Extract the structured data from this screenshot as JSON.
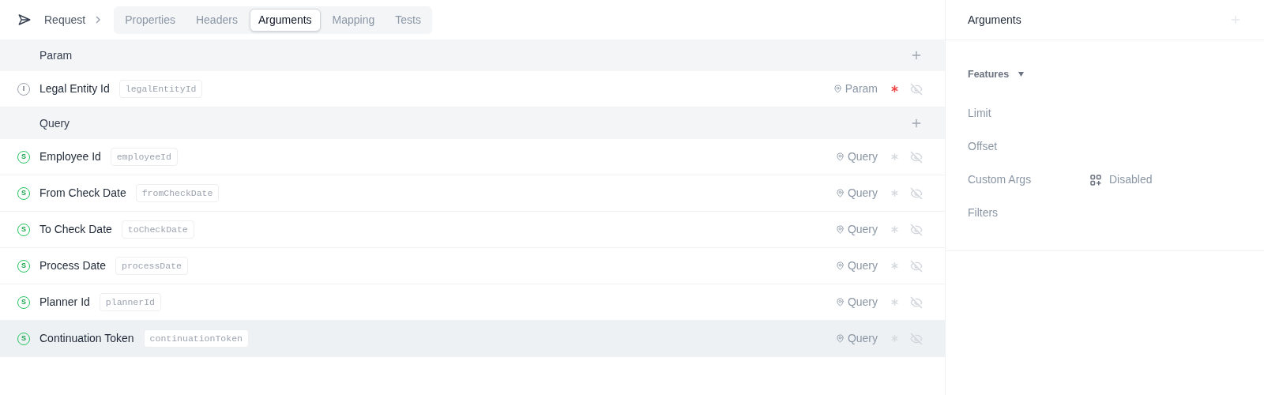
{
  "breadcrumb": {
    "label": "Request"
  },
  "tabs": [
    {
      "label": "Properties",
      "selected": false
    },
    {
      "label": "Headers",
      "selected": false
    },
    {
      "label": "Arguments",
      "selected": true
    },
    {
      "label": "Mapping",
      "selected": false
    },
    {
      "label": "Tests",
      "selected": false
    }
  ],
  "sections": [
    {
      "title": "Param",
      "rows": [
        {
          "name": "Legal Entity Id",
          "key": "legalEntityId",
          "kind": "integer",
          "type_letter": "I",
          "location": "Param",
          "required": true,
          "hovered": false
        }
      ]
    },
    {
      "title": "Query",
      "rows": [
        {
          "name": "Employee Id",
          "key": "employeeId",
          "kind": "string",
          "type_letter": "S",
          "location": "Query",
          "required": false,
          "hovered": false
        },
        {
          "name": "From Check Date",
          "key": "fromCheckDate",
          "kind": "string",
          "type_letter": "S",
          "location": "Query",
          "required": false,
          "hovered": false
        },
        {
          "name": "To Check Date",
          "key": "toCheckDate",
          "kind": "string",
          "type_letter": "S",
          "location": "Query",
          "required": false,
          "hovered": false
        },
        {
          "name": "Process Date",
          "key": "processDate",
          "kind": "string",
          "type_letter": "S",
          "location": "Query",
          "required": false,
          "hovered": false
        },
        {
          "name": "Planner Id",
          "key": "plannerId",
          "kind": "string",
          "type_letter": "S",
          "location": "Query",
          "required": false,
          "hovered": false
        },
        {
          "name": "Continuation Token",
          "key": "continuationToken",
          "kind": "string",
          "type_letter": "S",
          "location": "Query",
          "required": false,
          "hovered": true
        }
      ]
    }
  ],
  "panel": {
    "title": "Arguments",
    "features_label": "Features",
    "features": [
      {
        "label": "Limit"
      },
      {
        "label": "Offset"
      },
      {
        "label": "Custom Args",
        "value": "Disabled"
      },
      {
        "label": "Filters"
      }
    ]
  }
}
